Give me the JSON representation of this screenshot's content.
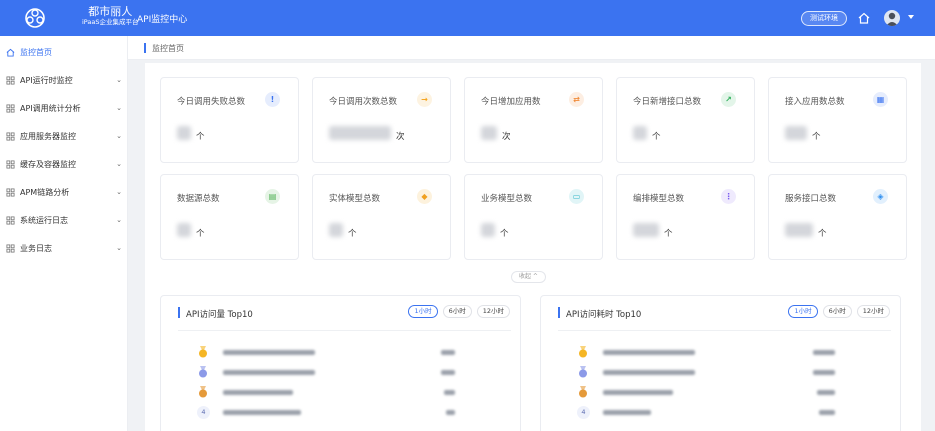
{
  "header": {
    "brand_name": "都市丽人",
    "brand_sub": "iPaaS企业集成平台",
    "app_title": "API监控中心",
    "env_badge": "测试环境"
  },
  "sidebar": {
    "items": [
      {
        "label": "监控首页",
        "icon": "home-icon",
        "active": true,
        "expandable": false
      },
      {
        "label": "API运行时监控",
        "icon": "grid-icon",
        "active": false,
        "expandable": true
      },
      {
        "label": "API调用统计分析",
        "icon": "grid-icon",
        "active": false,
        "expandable": true
      },
      {
        "label": "应用服务器监控",
        "icon": "grid-icon",
        "active": false,
        "expandable": true
      },
      {
        "label": "缓存及容器监控",
        "icon": "grid-icon",
        "active": false,
        "expandable": true
      },
      {
        "label": "APM链路分析",
        "icon": "grid-icon",
        "active": false,
        "expandable": true
      },
      {
        "label": "系统运行日志",
        "icon": "grid-icon",
        "active": false,
        "expandable": true
      },
      {
        "label": "业务日志",
        "icon": "grid-icon",
        "active": false,
        "expandable": true
      }
    ]
  },
  "breadcrumb": {
    "current": "监控首页"
  },
  "stats": [
    {
      "title": "今日调用失败总数",
      "unit": "个",
      "icon": "alert-icon",
      "color": "#3b73f0",
      "bg": "#e6edfd"
    },
    {
      "title": "今日调用次数总数",
      "unit": "次",
      "icon": "arrow-right-icon",
      "color": "#f5a623",
      "bg": "#fdf3e1"
    },
    {
      "title": "今日增加应用数",
      "unit": "次",
      "icon": "swap-icon",
      "color": "#f08c3a",
      "bg": "#fdeee2"
    },
    {
      "title": "今日新增接口总数",
      "unit": "个",
      "icon": "expand-icon",
      "color": "#2fae5a",
      "bg": "#e3f5e9"
    },
    {
      "title": "接入应用数总数",
      "unit": "个",
      "icon": "apps-icon",
      "color": "#3b73f0",
      "bg": "#e6edfd"
    },
    {
      "title": "数据源总数",
      "unit": "个",
      "icon": "database-icon",
      "color": "#4caf50",
      "bg": "#e6f4e6"
    },
    {
      "title": "实体模型总数",
      "unit": "个",
      "icon": "box-icon",
      "color": "#f0a020",
      "bg": "#fdf2dd"
    },
    {
      "title": "业务模型总数",
      "unit": "个",
      "icon": "card-icon",
      "color": "#36b8c8",
      "bg": "#e1f5f7"
    },
    {
      "title": "编排模型总数",
      "unit": "个",
      "icon": "flow-icon",
      "color": "#7b5cf0",
      "bg": "#efeafd"
    },
    {
      "title": "服务接口总数",
      "unit": "个",
      "icon": "tag-icon",
      "color": "#2f8ff0",
      "bg": "#e2f0fd"
    }
  ],
  "collapse_label": "收起 ^",
  "panels": [
    {
      "title": "API访问量 Top10",
      "ranges": [
        "1小时",
        "6小时",
        "12小时"
      ],
      "active_range": "1小时"
    },
    {
      "title": "API访问耗时 Top10",
      "ranges": [
        "1小时",
        "6小时",
        "12小时"
      ],
      "active_range": "1小时"
    }
  ],
  "rank_labels": [
    "4"
  ],
  "colors": {
    "primary": "#3b73f0",
    "gold": "#f5b625",
    "silver": "#8c9ae8",
    "bronze": "#e59a3a"
  }
}
